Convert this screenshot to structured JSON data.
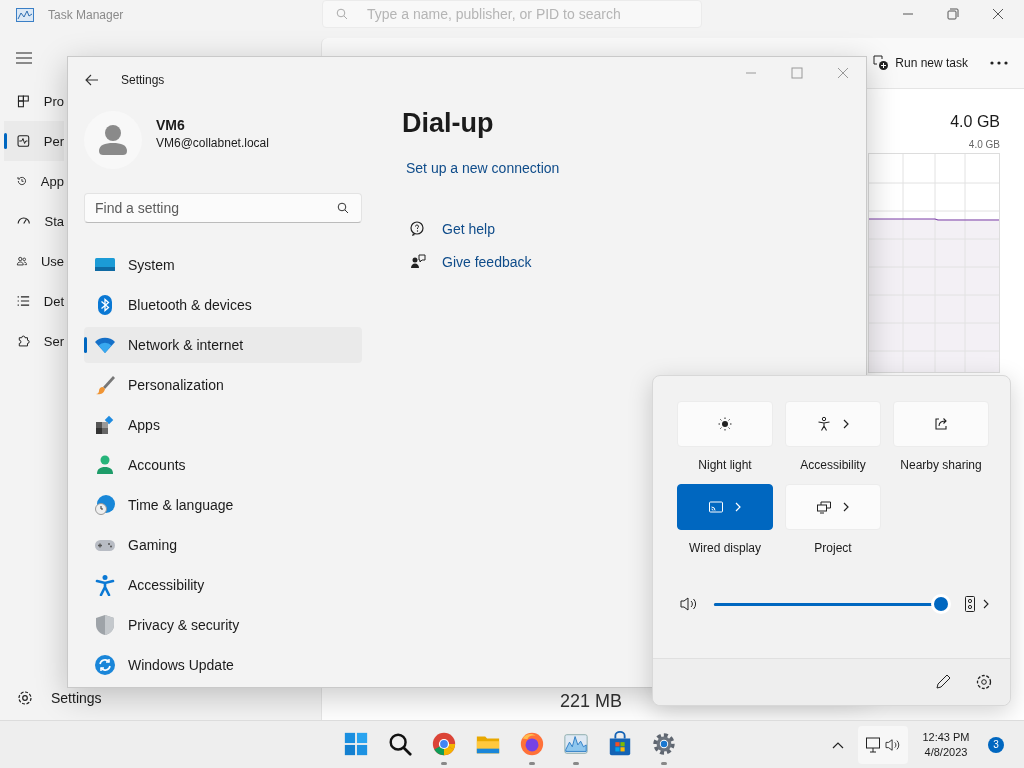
{
  "task_manager": {
    "title": "Task Manager",
    "search": {
      "placeholder": "Type a name, publisher, or PID to search"
    },
    "nav": [
      {
        "label": "Pro",
        "selected": false
      },
      {
        "label": "Per",
        "selected": true
      },
      {
        "label": "App",
        "selected": false
      },
      {
        "label": "Sta",
        "selected": false
      },
      {
        "label": "Use",
        "selected": false
      },
      {
        "label": "Det",
        "selected": false
      },
      {
        "label": "Ser",
        "selected": false
      }
    ],
    "nav_bottom": {
      "label": "Settings"
    },
    "toolbar": {
      "run_new_task": "Run new task"
    },
    "memory": {
      "total": "4.0 GB",
      "max": "4.0 GB",
      "in_use": "221 MB"
    }
  },
  "settings": {
    "title": "Settings",
    "profile": {
      "name": "VM6",
      "email": "VM6@collabnet.local"
    },
    "search": {
      "placeholder": "Find a setting"
    },
    "nav": [
      {
        "label": "System",
        "selected": false
      },
      {
        "label": "Bluetooth & devices",
        "selected": false
      },
      {
        "label": "Network & internet",
        "selected": true
      },
      {
        "label": "Personalization",
        "selected": false
      },
      {
        "label": "Apps",
        "selected": false
      },
      {
        "label": "Accounts",
        "selected": false
      },
      {
        "label": "Time & language",
        "selected": false
      },
      {
        "label": "Gaming",
        "selected": false
      },
      {
        "label": "Accessibility",
        "selected": false
      },
      {
        "label": "Privacy & security",
        "selected": false
      },
      {
        "label": "Windows Update",
        "selected": false
      }
    ],
    "page": {
      "title": "Dial-up",
      "links": [
        "Set up a new connection"
      ],
      "help": [
        "Get help",
        "Give feedback"
      ]
    }
  },
  "quick_settings": {
    "tiles": [
      {
        "label": "Night light",
        "on": false,
        "chevron": false
      },
      {
        "label": "Accessibility",
        "on": false,
        "chevron": true
      },
      {
        "label": "Nearby sharing",
        "on": false,
        "chevron": false
      },
      {
        "label": "Wired display",
        "on": true,
        "chevron": true
      },
      {
        "label": "Project",
        "on": false,
        "chevron": true
      }
    ],
    "volume": {
      "level": 1.0
    }
  },
  "taskbar": {
    "apps": [
      {
        "running": false
      },
      {
        "running": false
      },
      {
        "running": true
      },
      {
        "running": false
      },
      {
        "running": true
      },
      {
        "running": true
      },
      {
        "running": false
      },
      {
        "running": true
      }
    ],
    "clock": {
      "time": "12:43 PM",
      "date": "4/8/2023"
    },
    "notifications": "3"
  }
}
